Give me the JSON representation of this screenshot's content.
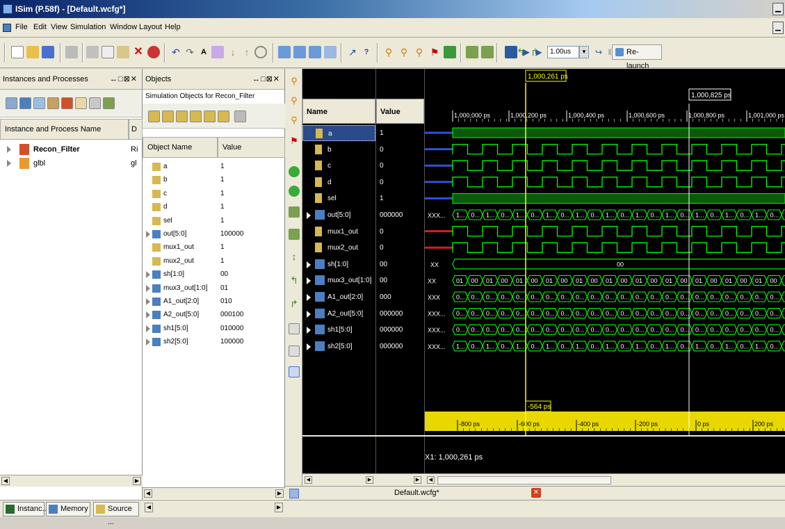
{
  "window": {
    "title": "ISim (P.58f) - [Default.wcfg*]"
  },
  "menu": [
    "File",
    "Edit",
    "View",
    "Simulation",
    "Window",
    "Layout",
    "Help"
  ],
  "toolbar": {
    "time_value": "1.00us",
    "relaunch_label": "Re-launch"
  },
  "instances_panel": {
    "title": "Instances and Processes",
    "column_header": "Instance and Process Name",
    "column_header2": "D",
    "items": [
      {
        "name": "Recon_Filter",
        "extra": "Ri",
        "icon": "component-icon"
      },
      {
        "name": "glbl",
        "extra": "gl",
        "icon": "module-icon"
      }
    ]
  },
  "objects_panel": {
    "title": "Objects",
    "subtitle": "Simulation Objects for Recon_Filter",
    "col_name": "Object Name",
    "col_value": "Value",
    "items": [
      {
        "name": "a",
        "value": "1",
        "bus": false
      },
      {
        "name": "b",
        "value": "1",
        "bus": false
      },
      {
        "name": "c",
        "value": "1",
        "bus": false
      },
      {
        "name": "d",
        "value": "1",
        "bus": false
      },
      {
        "name": "sel",
        "value": "1",
        "bus": false
      },
      {
        "name": "out[5:0]",
        "value": "100000",
        "bus": true
      },
      {
        "name": "mux1_out",
        "value": "1",
        "bus": false
      },
      {
        "name": "mux2_out",
        "value": "1",
        "bus": false
      },
      {
        "name": "sh[1:0]",
        "value": "00",
        "bus": true
      },
      {
        "name": "mux3_out[1:0]",
        "value": "01",
        "bus": true
      },
      {
        "name": "A1_out[2:0]",
        "value": "010",
        "bus": true
      },
      {
        "name": "A2_out[5:0]",
        "value": "000100",
        "bus": true
      },
      {
        "name": "sh1[5:0]",
        "value": "010000",
        "bus": true
      },
      {
        "name": "sh2[5:0]",
        "value": "100000",
        "bus": true
      }
    ]
  },
  "wave": {
    "name_header": "Name",
    "value_header": "Value",
    "signals": [
      {
        "name": "a",
        "value": "1",
        "bus": false
      },
      {
        "name": "b",
        "value": "0",
        "bus": false
      },
      {
        "name": "c",
        "value": "0",
        "bus": false
      },
      {
        "name": "d",
        "value": "0",
        "bus": false
      },
      {
        "name": "sel",
        "value": "1",
        "bus": false
      },
      {
        "name": "out[5:0]",
        "value": "000000",
        "bus": true
      },
      {
        "name": "mux1_out",
        "value": "0",
        "bus": false
      },
      {
        "name": "mux2_out",
        "value": "0",
        "bus": false
      },
      {
        "name": "sh[1:0]",
        "value": "00",
        "bus": true
      },
      {
        "name": "mux3_out[1:0]",
        "value": "00",
        "bus": true
      },
      {
        "name": "A1_out[2:0]",
        "value": "000",
        "bus": true
      },
      {
        "name": "A2_out[5:0]",
        "value": "000000",
        "bus": true
      },
      {
        "name": "sh1[5:0]",
        "value": "000000",
        "bus": true
      },
      {
        "name": "sh2[5:0]",
        "value": "000000",
        "bus": true
      }
    ],
    "cursor_time": "1,000,261 ps",
    "marker_time": "1,000,825 ps",
    "delta_time": "-564 ps",
    "x1_readout": "X1: 1,000,261 ps",
    "time_ticks": [
      "1,000,000 ps",
      "1,000,200 ps",
      "1,000,400 ps",
      "1,000,600 ps",
      "1,000,800 ps",
      "1,001,000 ps"
    ],
    "rel_ticks": [
      "-800 ps",
      "-600 ps",
      "-400 ps",
      "-200 ps",
      "0 ps",
      "200 ps"
    ],
    "bus_labels": {
      "out": [
        "XXX...",
        "1...",
        "0...",
        "1..."
      ],
      "sh": [
        "XX",
        "00"
      ],
      "mux3": [
        "XX",
        "01",
        "00"
      ],
      "A1": [
        "XXX",
        "0..."
      ],
      "A2": [
        "XXX...",
        "0..."
      ],
      "sh1": [
        "XXX...",
        "0..."
      ],
      "sh2": [
        "XXX...",
        "1...",
        "0..."
      ]
    },
    "colors": {
      "signal": "#00ff00",
      "cursor": "#ffff00",
      "marker": "#ffffff",
      "bg": "#000000"
    }
  },
  "bottom": {
    "tabs": [
      "Instanc...",
      "Memory",
      "Source ..."
    ],
    "file_tab": "Default.wcfg*"
  }
}
